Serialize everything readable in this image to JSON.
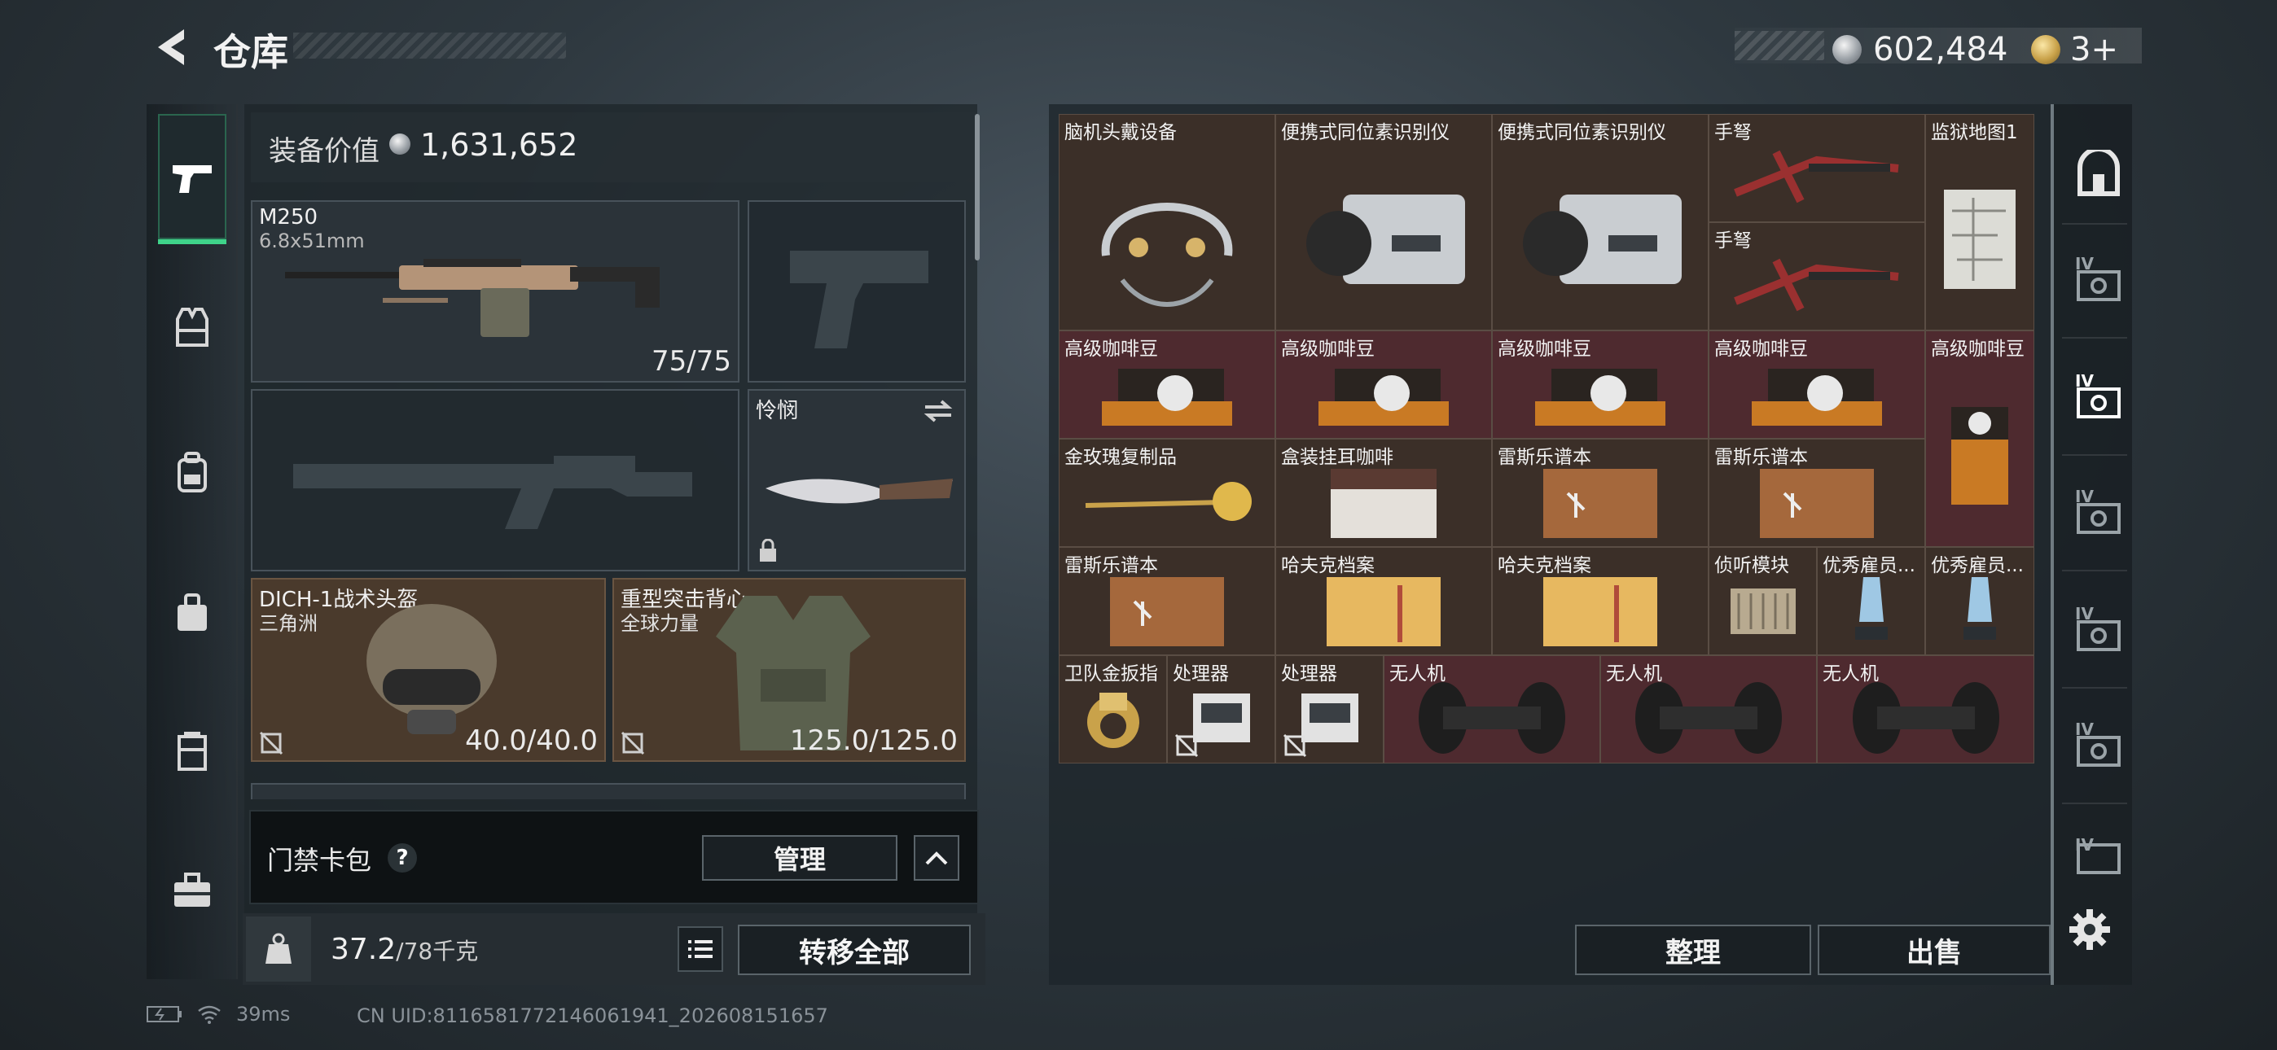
{
  "header": {
    "title": "仓库",
    "silver_balance": "602,484",
    "gold_balance": "3+"
  },
  "left_nav": {
    "items": [
      "weapons",
      "armor-vest",
      "backpack",
      "bag",
      "container",
      "toolbox"
    ]
  },
  "equipment": {
    "value_label": "装备价值",
    "value": "1,631,652",
    "primary_weapon": {
      "name": "M250",
      "ammo_type": "6.8x51mm",
      "ammo": "75/75"
    },
    "melee": {
      "name": "怜悯"
    },
    "helmet": {
      "name": "DICH-1战术头盔",
      "origin": "三角洲",
      "durability": "40.0/40.0"
    },
    "armor": {
      "name": "重型突击背心",
      "origin": "全球力量",
      "durability": "125.0/125.0"
    }
  },
  "card_pack": {
    "label": "门禁卡包",
    "help": "?",
    "manage_label": "管理"
  },
  "weight": {
    "current": "37.2",
    "max": "/78千克",
    "transfer_all_label": "转移全部"
  },
  "status": {
    "uid": "CN UID:8116581772146061941_202608151657",
    "ping": "39ms"
  },
  "storage": {
    "items": [
      {
        "label": "脑机头戴设备"
      },
      {
        "label": "便携式同位素识别仪"
      },
      {
        "label": "便携式同位素识别仪"
      },
      {
        "label": "手弩"
      },
      {
        "label": "手弩"
      },
      {
        "label": "监狱地图1"
      },
      {
        "label": "高级咖啡豆"
      },
      {
        "label": "高级咖啡豆"
      },
      {
        "label": "高级咖啡豆"
      },
      {
        "label": "高级咖啡豆"
      },
      {
        "label": "高级咖啡豆"
      },
      {
        "label": "金玫瑰复制品"
      },
      {
        "label": "盒装挂耳咖啡"
      },
      {
        "label": "雷斯乐谱本"
      },
      {
        "label": "雷斯乐谱本"
      },
      {
        "label": "雷斯乐谱本"
      },
      {
        "label": "哈夫克档案"
      },
      {
        "label": "哈夫克档案"
      },
      {
        "label": "侦听模块"
      },
      {
        "label": "优秀雇员..."
      },
      {
        "label": "优秀雇员..."
      },
      {
        "label": "卫队金扳指"
      },
      {
        "label": "处理器"
      },
      {
        "label": "处理器"
      },
      {
        "label": "无人机"
      },
      {
        "label": "无人机"
      },
      {
        "label": "无人机"
      }
    ],
    "sort_label": "整理",
    "sell_label": "出售"
  },
  "right_tabs": {
    "items": [
      "home-tab",
      "tier-iv-tab",
      "tier-iv-tab",
      "tier-iv-tab",
      "tier-iv-tab",
      "tier-iv-tab",
      "tier-iv-tab"
    ],
    "tier_label": "IV"
  }
}
